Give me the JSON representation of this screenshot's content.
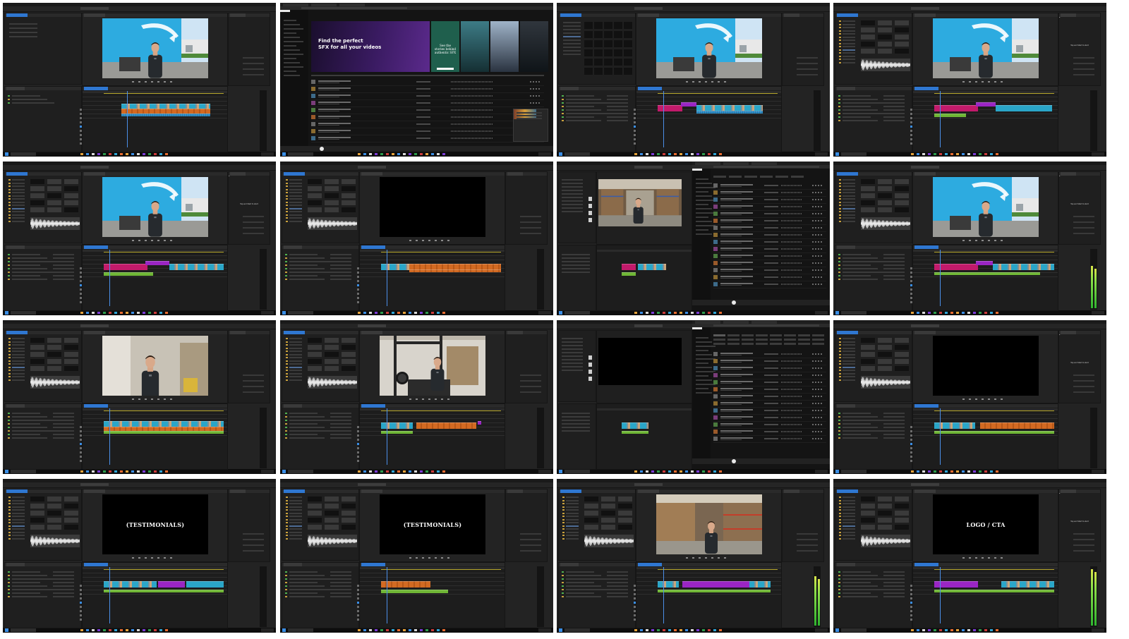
{
  "grid": {
    "tiles": [
      {
        "kind": "premiere",
        "viewer": "presenter-wall",
        "layout": "empty-project"
      },
      {
        "kind": "browser-hero"
      },
      {
        "kind": "premiere",
        "viewer": "presenter-wall",
        "layout": "media-grid"
      },
      {
        "kind": "premiere",
        "viewer": "presenter-wall",
        "layout": "tree",
        "right_text": "Tap and Start to start"
      },
      {
        "kind": "premiere",
        "viewer": "presenter-wall",
        "layout": "tree",
        "right_text": "Tap and Start to start"
      },
      {
        "kind": "premiere",
        "viewer": "black",
        "layout": "tree"
      },
      {
        "kind": "split-browser",
        "viewer": "warehouse"
      },
      {
        "kind": "premiere",
        "viewer": "presenter-wall",
        "layout": "tree",
        "right_text": "Tap and Start to start"
      },
      {
        "kind": "premiere",
        "viewer": "indoor-presenter",
        "layout": "tree"
      },
      {
        "kind": "premiere",
        "viewer": "forklift",
        "layout": "tree"
      },
      {
        "kind": "split-browser-list",
        "viewer": "black"
      },
      {
        "kind": "premiere",
        "viewer": "black",
        "layout": "tree",
        "right_text": "Tap and Start to start"
      },
      {
        "kind": "premiere",
        "viewer": "black",
        "layout": "tree",
        "overlay_text": "(TESTIMONIALS)"
      },
      {
        "kind": "premiere",
        "viewer": "black",
        "layout": "tree",
        "overlay_text": "(TESTIMONIALS)"
      },
      {
        "kind": "premiere",
        "viewer": "warehouse-presenter",
        "layout": "tree"
      },
      {
        "kind": "premiere",
        "viewer": "black",
        "layout": "tree",
        "overlay_text": "LOGO / CTA",
        "right_text": "Tap and Start to start"
      }
    ]
  },
  "sfx_site": {
    "hero_headline_line1": "Find the perfect",
    "hero_headline_line2": "SFX for all your videos",
    "card_text_line1": "See the",
    "card_text_line2": "stories behind",
    "card_text_line3": "authentic SFX"
  },
  "colors": {
    "panel": "#1f1f1f",
    "accent_blue": "#2f77d1",
    "clip_video": "#2aa6c8",
    "clip_orange": "#d36a22",
    "clip_magenta": "#c21a6b",
    "clip_purple": "#9a25c4",
    "clip_green": "#6fb635"
  }
}
